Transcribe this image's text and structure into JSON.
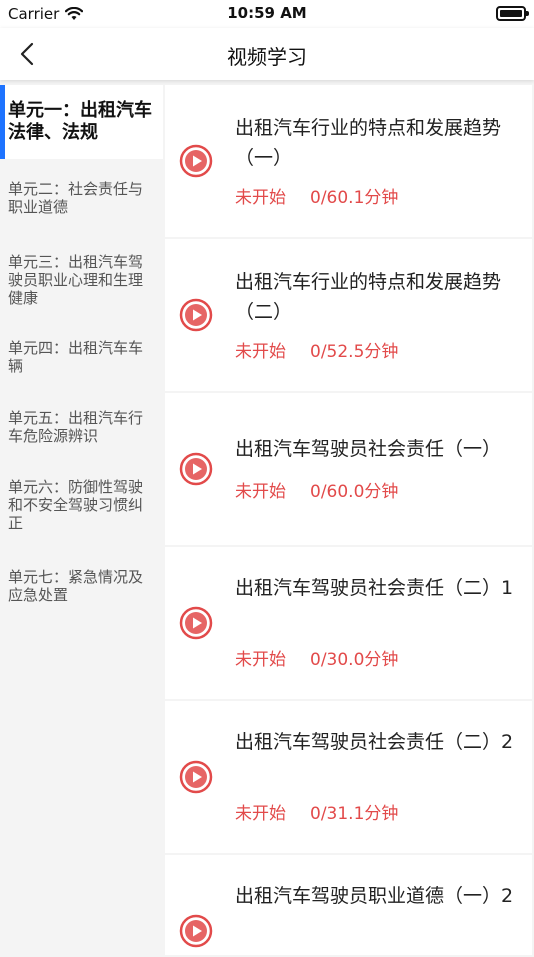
{
  "status_bar": {
    "carrier": "Carrier",
    "time": "10:59 AM"
  },
  "nav": {
    "title": "视频学习",
    "back_icon": "chevron-left-icon"
  },
  "colors": {
    "accent_blue": "#1e73ff",
    "status_red": "#e24a4a",
    "play_red": "#e24a4a"
  },
  "sidebar": {
    "items": [
      {
        "label": "单元一：出租汽车法律、法规",
        "active": true
      },
      {
        "label": "单元二：社会责任与职业道德",
        "active": false
      },
      {
        "label": "单元三：出租汽车驾驶员职业心理和生理健康",
        "active": false
      },
      {
        "label": "单元四：出租汽车车辆",
        "active": false
      },
      {
        "label": "单元五：出租汽车行车危险源辨识",
        "active": false
      },
      {
        "label": "单元六：防御性驾驶和不安全驾驶习惯纠正",
        "active": false
      },
      {
        "label": "单元七：紧急情况及应急处置",
        "active": false
      }
    ]
  },
  "videos": [
    {
      "title": "出租汽车行业的特点和发展趋势（一）",
      "status": "未开始",
      "progress": "0/60.1分钟"
    },
    {
      "title": "出租汽车行业的特点和发展趋势（二）",
      "status": "未开始",
      "progress": "0/52.5分钟"
    },
    {
      "title": "出租汽车驾驶员社会责任（一）",
      "status": "未开始",
      "progress": "0/60.0分钟"
    },
    {
      "title": "出租汽车驾驶员社会责任（二）1",
      "status": "未开始",
      "progress": "0/30.0分钟"
    },
    {
      "title": "出租汽车驾驶员社会责任（二）2",
      "status": "未开始",
      "progress": "0/31.1分钟"
    },
    {
      "title": "出租汽车驾驶员职业道德（一）2",
      "status": "",
      "progress": ""
    }
  ]
}
